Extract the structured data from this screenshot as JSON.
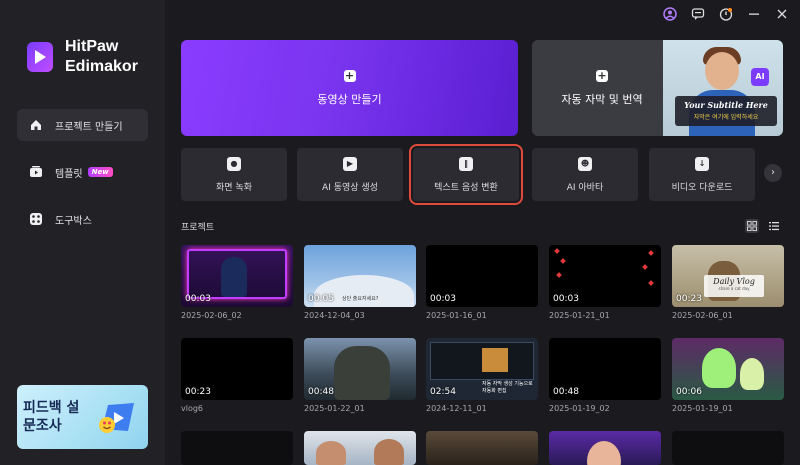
{
  "app": {
    "name_line1": "HitPaw",
    "name_line2": "Edimakor"
  },
  "sidebar": {
    "items": [
      {
        "label": "프로젝트 만들기",
        "icon": "home-icon",
        "active": true
      },
      {
        "label": "템플릿",
        "icon": "template-icon",
        "badge": "New"
      },
      {
        "label": "도구박스",
        "icon": "toolbox-icon"
      }
    ],
    "feedback": {
      "line1": "피드백 설",
      "line2": "문조사"
    }
  },
  "hero": {
    "create_label": "동영상 만들기",
    "subtitle_label": "자동 자막 및 번역",
    "subtitle_art": {
      "chip": "AI",
      "main": "Your Subtitle Here",
      "sub": "자막은 여기에 입력하세요"
    }
  },
  "tools": [
    {
      "label": "화면 녹화",
      "icon": "screen-record-icon"
    },
    {
      "label": "AI 동영상 생성",
      "icon": "ai-video-icon"
    },
    {
      "label": "텍스트 음성 변환",
      "icon": "text-to-speech-icon",
      "selected": true
    },
    {
      "label": "AI 아바타",
      "icon": "avatar-icon"
    },
    {
      "label": "비디오 다운로드",
      "icon": "download-icon"
    }
  ],
  "projects": {
    "title": "프로젝트",
    "items": [
      {
        "duration": "00:03",
        "name": "2025-02-06_02"
      },
      {
        "duration": "00:05",
        "name": "2024-12-04_03",
        "overlay_text": "상단 출요자세요?"
      },
      {
        "duration": "00:03",
        "name": "2025-01-16_01"
      },
      {
        "duration": "00:03",
        "name": "2025-01-21_01"
      },
      {
        "duration": "00:23",
        "name": "2025-02-06_01",
        "overlay_title": "Daily Vlog",
        "overlay_sub": "share a cat day"
      },
      {
        "duration": "00:23",
        "name": "vlog6"
      },
      {
        "duration": "00:48",
        "name": "2025-01-22_01"
      },
      {
        "duration": "02:54",
        "name": "2024-12-11_01",
        "overlay_text": "자동 자막 생성 기능으로 자동화 편집"
      },
      {
        "duration": "00:48",
        "name": "2025-01-19_02"
      },
      {
        "duration": "00:06",
        "name": "2025-01-19_01"
      }
    ]
  },
  "colors": {
    "accent": "#7b3cff",
    "selection_outline": "#e04a3b",
    "background": "#1b1b1f",
    "sidebar": "#222226"
  }
}
